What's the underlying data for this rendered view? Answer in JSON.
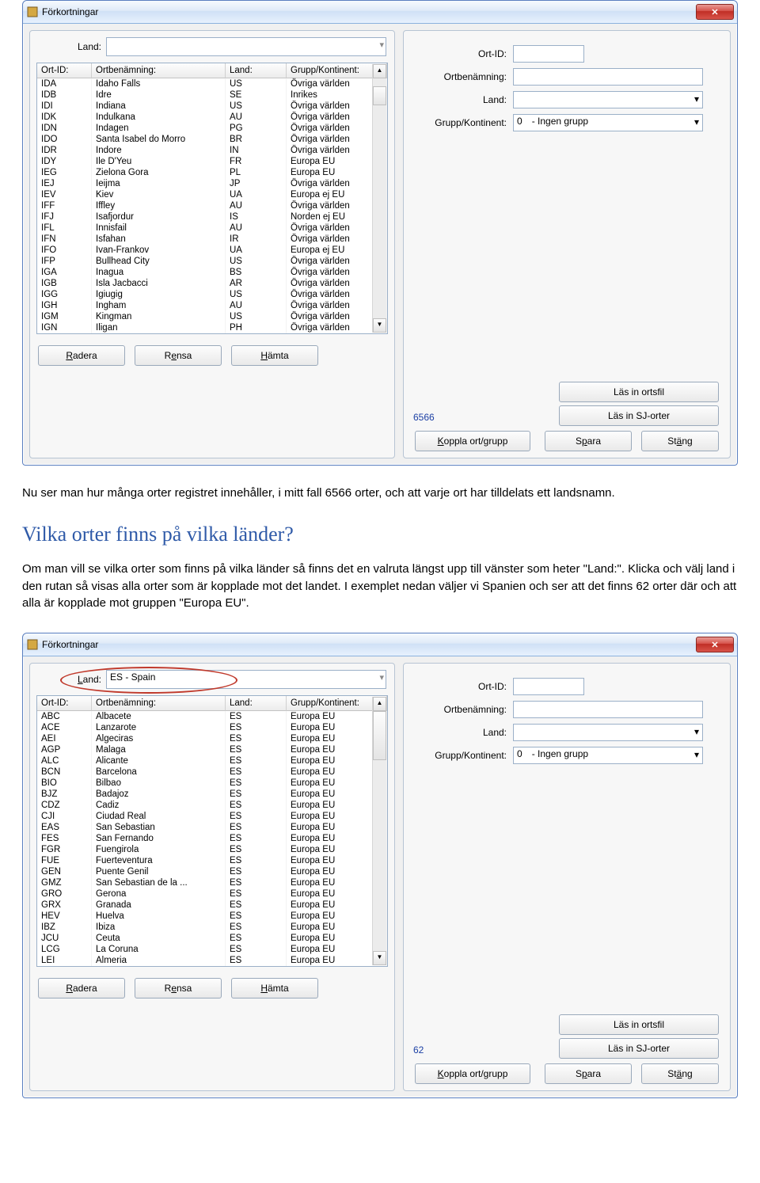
{
  "windowTitle": "Förkortningar",
  "landLabel": "Land:",
  "headers": {
    "id": "Ort-ID:",
    "name": "Ortbenämning:",
    "land": "Land:",
    "grp": "Grupp/Kontinent:"
  },
  "rows1": [
    {
      "id": "IDA",
      "name": "Idaho Falls",
      "land": "US",
      "grp": "Övriga världen"
    },
    {
      "id": "IDB",
      "name": "Idre",
      "land": "SE",
      "grp": "Inrikes"
    },
    {
      "id": "IDI",
      "name": "Indiana",
      "land": "US",
      "grp": "Övriga världen"
    },
    {
      "id": "IDK",
      "name": "Indulkana",
      "land": "AU",
      "grp": "Övriga världen"
    },
    {
      "id": "IDN",
      "name": "Indagen",
      "land": "PG",
      "grp": "Övriga världen"
    },
    {
      "id": "IDO",
      "name": "Santa Isabel do Morro",
      "land": "BR",
      "grp": "Övriga världen"
    },
    {
      "id": "IDR",
      "name": "Indore",
      "land": "IN",
      "grp": "Övriga världen"
    },
    {
      "id": "IDY",
      "name": "Ile D'Yeu",
      "land": "FR",
      "grp": "Europa EU"
    },
    {
      "id": "IEG",
      "name": "Zielona Gora",
      "land": "PL",
      "grp": "Europa EU"
    },
    {
      "id": "IEJ",
      "name": "Ieijma",
      "land": "JP",
      "grp": "Övriga världen"
    },
    {
      "id": "IEV",
      "name": "Kiev",
      "land": "UA",
      "grp": "Europa ej EU"
    },
    {
      "id": "IFF",
      "name": "Iffley",
      "land": "AU",
      "grp": "Övriga världen"
    },
    {
      "id": "IFJ",
      "name": "Isafjordur",
      "land": "IS",
      "grp": "Norden ej EU"
    },
    {
      "id": "IFL",
      "name": "Innisfail",
      "land": "AU",
      "grp": "Övriga världen"
    },
    {
      "id": "IFN",
      "name": "Isfahan",
      "land": "IR",
      "grp": "Övriga världen"
    },
    {
      "id": "IFO",
      "name": "Ivan-Frankov",
      "land": "UA",
      "grp": "Europa ej EU"
    },
    {
      "id": "IFP",
      "name": "Bullhead City",
      "land": "US",
      "grp": "Övriga världen"
    },
    {
      "id": "IGA",
      "name": "Inagua",
      "land": "BS",
      "grp": "Övriga världen"
    },
    {
      "id": "IGB",
      "name": "Isla Jacbacci",
      "land": "AR",
      "grp": "Övriga världen"
    },
    {
      "id": "IGG",
      "name": "Igiugig",
      "land": "US",
      "grp": "Övriga världen"
    },
    {
      "id": "IGH",
      "name": "Ingham",
      "land": "AU",
      "grp": "Övriga världen"
    },
    {
      "id": "IGM",
      "name": "Kingman",
      "land": "US",
      "grp": "Övriga världen"
    },
    {
      "id": "IGN",
      "name": "Iligan",
      "land": "PH",
      "grp": "Övriga världen"
    }
  ],
  "rows2": [
    {
      "id": "ABC",
      "name": "Albacete",
      "land": "ES",
      "grp": "Europa EU"
    },
    {
      "id": "ACE",
      "name": "Lanzarote",
      "land": "ES",
      "grp": "Europa EU"
    },
    {
      "id": "AEI",
      "name": "Algeciras",
      "land": "ES",
      "grp": "Europa EU"
    },
    {
      "id": "AGP",
      "name": "Malaga",
      "land": "ES",
      "grp": "Europa EU"
    },
    {
      "id": "ALC",
      "name": "Alicante",
      "land": "ES",
      "grp": "Europa EU"
    },
    {
      "id": "BCN",
      "name": "Barcelona",
      "land": "ES",
      "grp": "Europa EU"
    },
    {
      "id": "BIO",
      "name": "Bilbao",
      "land": "ES",
      "grp": "Europa EU"
    },
    {
      "id": "BJZ",
      "name": "Badajoz",
      "land": "ES",
      "grp": "Europa EU"
    },
    {
      "id": "CDZ",
      "name": "Cadiz",
      "land": "ES",
      "grp": "Europa EU"
    },
    {
      "id": "CJI",
      "name": "Ciudad Real",
      "land": "ES",
      "grp": "Europa EU"
    },
    {
      "id": "EAS",
      "name": "San Sebastian",
      "land": "ES",
      "grp": "Europa EU"
    },
    {
      "id": "FES",
      "name": "San Fernando",
      "land": "ES",
      "grp": "Europa EU"
    },
    {
      "id": "FGR",
      "name": "Fuengirola",
      "land": "ES",
      "grp": "Europa EU"
    },
    {
      "id": "FUE",
      "name": "Fuerteventura",
      "land": "ES",
      "grp": "Europa EU"
    },
    {
      "id": "GEN",
      "name": "Puente Genil",
      "land": "ES",
      "grp": "Europa EU"
    },
    {
      "id": "GMZ",
      "name": "San Sebastian de la ...",
      "land": "ES",
      "grp": "Europa EU"
    },
    {
      "id": "GRO",
      "name": "Gerona",
      "land": "ES",
      "grp": "Europa EU"
    },
    {
      "id": "GRX",
      "name": "Granada",
      "land": "ES",
      "grp": "Europa EU"
    },
    {
      "id": "HEV",
      "name": "Huelva",
      "land": "ES",
      "grp": "Europa EU"
    },
    {
      "id": "IBZ",
      "name": "Ibiza",
      "land": "ES",
      "grp": "Europa EU"
    },
    {
      "id": "JCU",
      "name": "Ceuta",
      "land": "ES",
      "grp": "Europa EU"
    },
    {
      "id": "LCG",
      "name": "La Coruna",
      "land": "ES",
      "grp": "Europa EU"
    },
    {
      "id": "LEI",
      "name": "Almeria",
      "land": "ES",
      "grp": "Europa EU"
    }
  ],
  "formLabels": {
    "ortid": "Ort-ID:",
    "ortben": "Ortbenämning:",
    "land": "Land:",
    "grupp": "Grupp/Kontinent:"
  },
  "gruppValue": "0",
  "gruppText": "- Ingen grupp",
  "count1": "6566",
  "count2": "62",
  "buttons": {
    "radera": "Radera",
    "rensa": "Rensa",
    "hamta": "Hämta",
    "koppla": "Koppla ort/grupp",
    "spara": "Spara",
    "stang": "Stäng",
    "lasinort": "Läs in ortsfil",
    "lasinsj": "Läs in SJ-orter"
  },
  "prose1": "Nu ser man hur många orter registret innehåller, i mitt fall 6566 orter, och att varje ort har tilldelats ett landsnamn.",
  "heading": "Vilka orter finns på vilka länder?",
  "prose2a": "Om man vill se vilka orter som finns på vilka länder så finns det en valruta längst upp till vänster som heter \"Land:\". Klicka och välj land i den rutan så visas alla orter som är kopplade mot det landet. I exemplet nedan väljer vi Spanien och ser att det finns 62 orter där och att alla är kopplade mot gruppen \"Europa EU\".",
  "land2Value": "ES    - Spain"
}
